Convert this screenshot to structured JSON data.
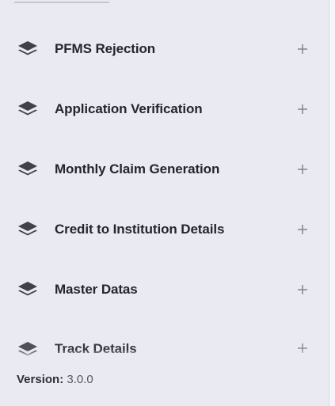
{
  "menu": {
    "items": [
      {
        "label": "PFMS Rejection",
        "icon": "layers-icon",
        "action": "+"
      },
      {
        "label": "Application Verification",
        "icon": "layers-icon",
        "action": "+"
      },
      {
        "label": "Monthly Claim Generation",
        "icon": "layers-icon",
        "action": "+"
      },
      {
        "label": "Credit to Institution Details",
        "icon": "layers-icon",
        "action": "+"
      },
      {
        "label": "Master Datas",
        "icon": "layers-icon",
        "action": "+"
      },
      {
        "label": "Track Details",
        "icon": "layers-icon",
        "action": "+"
      }
    ]
  },
  "footer": {
    "version_label": "Version:",
    "version_value": "3.0.0"
  },
  "colors": {
    "background": "#e9eaf2",
    "text": "#24262e",
    "icon": "#3f424b",
    "expand": "#7b7f8b"
  }
}
